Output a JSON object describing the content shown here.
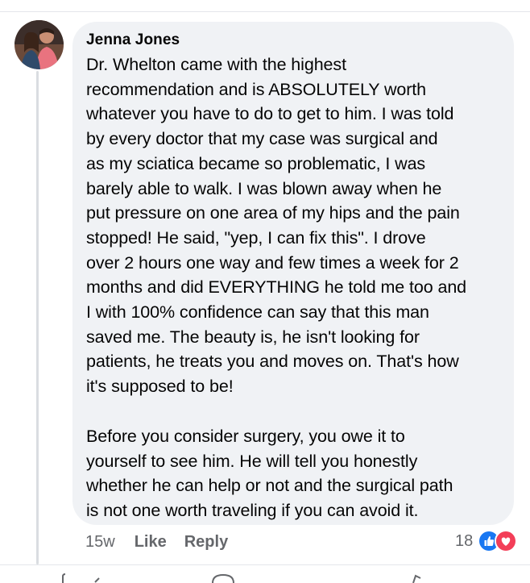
{
  "comment": {
    "author": "Jenna Jones",
    "paragraphs": [
      "Dr. Whelton came with the highest\nrecommendation and is ABSOLUTELY worth\nwhatever you have to do to get to him. I was told\nby every doctor that my case was surgical and\nas my sciatica became so problematic, I was\nbarely able to walk. I was blown away when he\nput pressure on one area of my hips and the pain\nstopped! He said, \"yep, I can fix this\". I drove\nover 2 hours one way and few times a week for 2\nmonths and did EVERYTHING he told me too and\nI with 100% confidence can say that this man\nsaved me. The beauty is, he isn't looking for\npatients, he treats you and moves on. That's how\nit's supposed to be!",
      "Before you consider surgery, you owe it to\nyourself to see him. He will tell you honestly\nwhether he can help or not and the surgical path\nis not one worth traveling if you can avoid it."
    ],
    "timestamp": "15w",
    "like_label": "Like",
    "reply_label": "Reply",
    "reaction_count": "18",
    "reaction_icons": [
      "like-reaction-icon",
      "love-reaction-icon"
    ]
  },
  "colors": {
    "bubble_bg": "#f0f2f5",
    "meta_text": "#65676b",
    "like_blue": "#1877f2",
    "love_red": "#f33e58"
  }
}
